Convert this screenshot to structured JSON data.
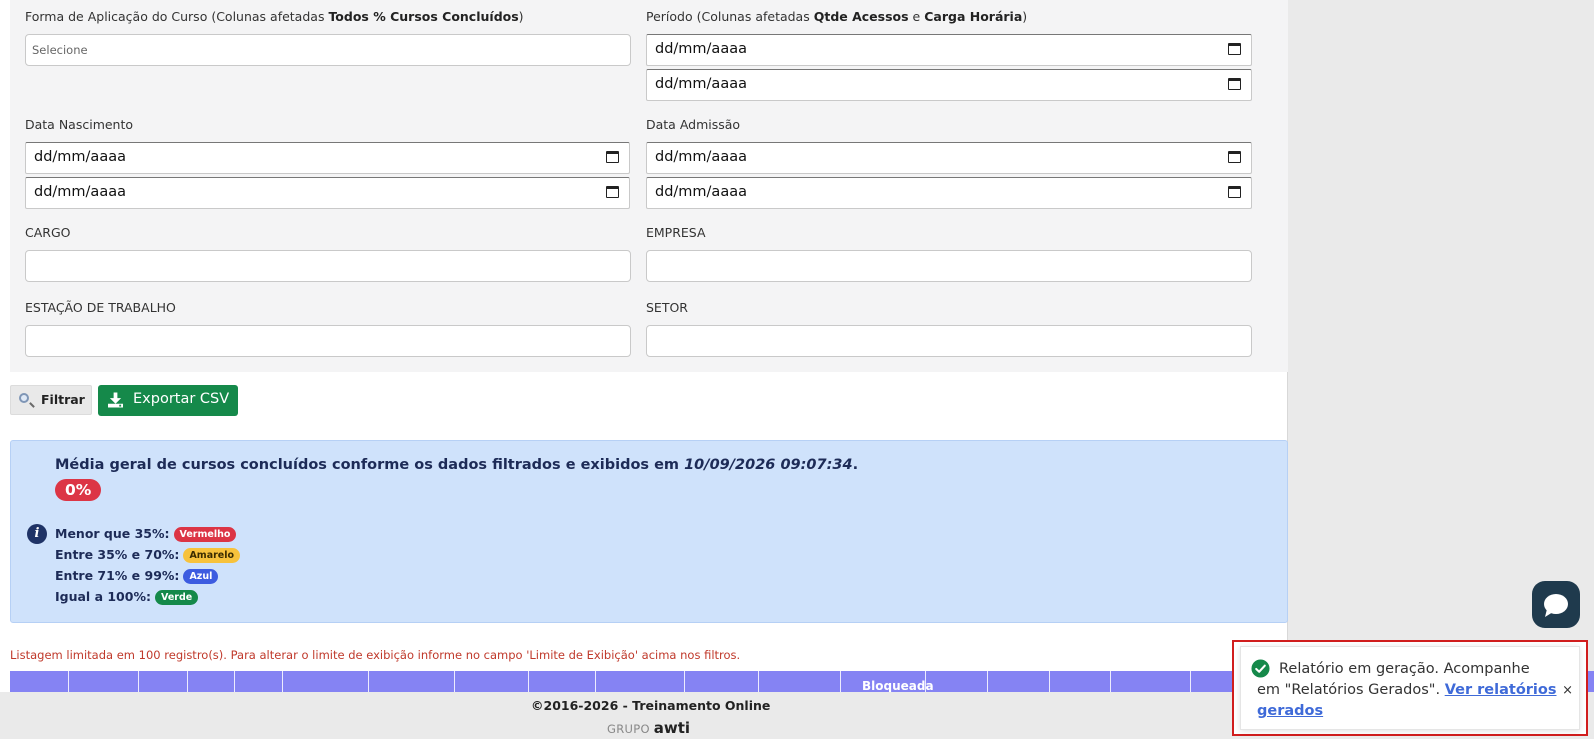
{
  "filters": {
    "forma": {
      "label_prefix": "Forma de Aplicação do Curso (Colunas afetadas ",
      "label_bold": "Todos % Cursos Concluídos",
      "label_suffix": ")",
      "placeholder": "Selecione"
    },
    "periodo": {
      "label_prefix": "Período (Colunas afetadas ",
      "label_bold1": "Qtde Acessos",
      "label_mid": " e ",
      "label_bold2": "Carga Horária",
      "label_suffix": ")",
      "from": "dd/mm/aaaa",
      "to": "dd/mm/aaaa"
    },
    "nascimento": {
      "label": "Data Nascimento",
      "from": "dd/mm/aaaa",
      "to": "dd/mm/aaaa"
    },
    "admissao": {
      "label": "Data Admissão",
      "from": "dd/mm/aaaa",
      "to": "dd/mm/aaaa"
    },
    "cargo": {
      "label": "CARGO",
      "value": ""
    },
    "empresa": {
      "label": "EMPRESA",
      "value": ""
    },
    "estacao": {
      "label": "ESTAÇÃO DE TRABALHO",
      "value": ""
    },
    "setor": {
      "label": "SETOR",
      "value": ""
    }
  },
  "actions": {
    "filtrar": "Filtrar",
    "exportar": "Exportar CSV"
  },
  "summary": {
    "title": "Média geral de cursos concluídos conforme os dados filtrados e exibidos em ",
    "timestamp": "10/09/2026 09:07:34",
    "title_end": ".",
    "percent": "0%",
    "legend": [
      {
        "text": "Menor que 35%:",
        "tag": "Vermelho",
        "color": "#dc3545",
        "text_color": "#ffffff"
      },
      {
        "text": "Entre 35% e 70%:",
        "tag": "Amarelo",
        "color": "#f7c23c",
        "text_color": "#3a2c00"
      },
      {
        "text": "Entre 71% e 99%:",
        "tag": "Azul",
        "color": "#3d5ce0",
        "text_color": "#ffffff"
      },
      {
        "text": "Igual a 100%:",
        "tag": "Verde",
        "color": "#15894a",
        "text_color": "#ffffff"
      }
    ]
  },
  "limit_note": "Listagem limitada em 100 registro(s). Para alterar o limite de exibição informe no campo 'Limite de Exibição' acima nos filtros.",
  "table": {
    "visible_header": "Bloqueada"
  },
  "footer": {
    "copyright": "©2016-2026 - Treinamento Online",
    "group": "GRUPO",
    "brand": "awti"
  },
  "toast": {
    "message": "Relatório em geração. Acompanhe em \"Relatórios Gerados\". ",
    "link": "Ver relatórios gerados",
    "close": "×"
  },
  "colors": {
    "accent_green": "#15894a",
    "table_header": "#8583f3",
    "info_bg": "#cfe2fb",
    "alert_red": "#d11d1d"
  }
}
